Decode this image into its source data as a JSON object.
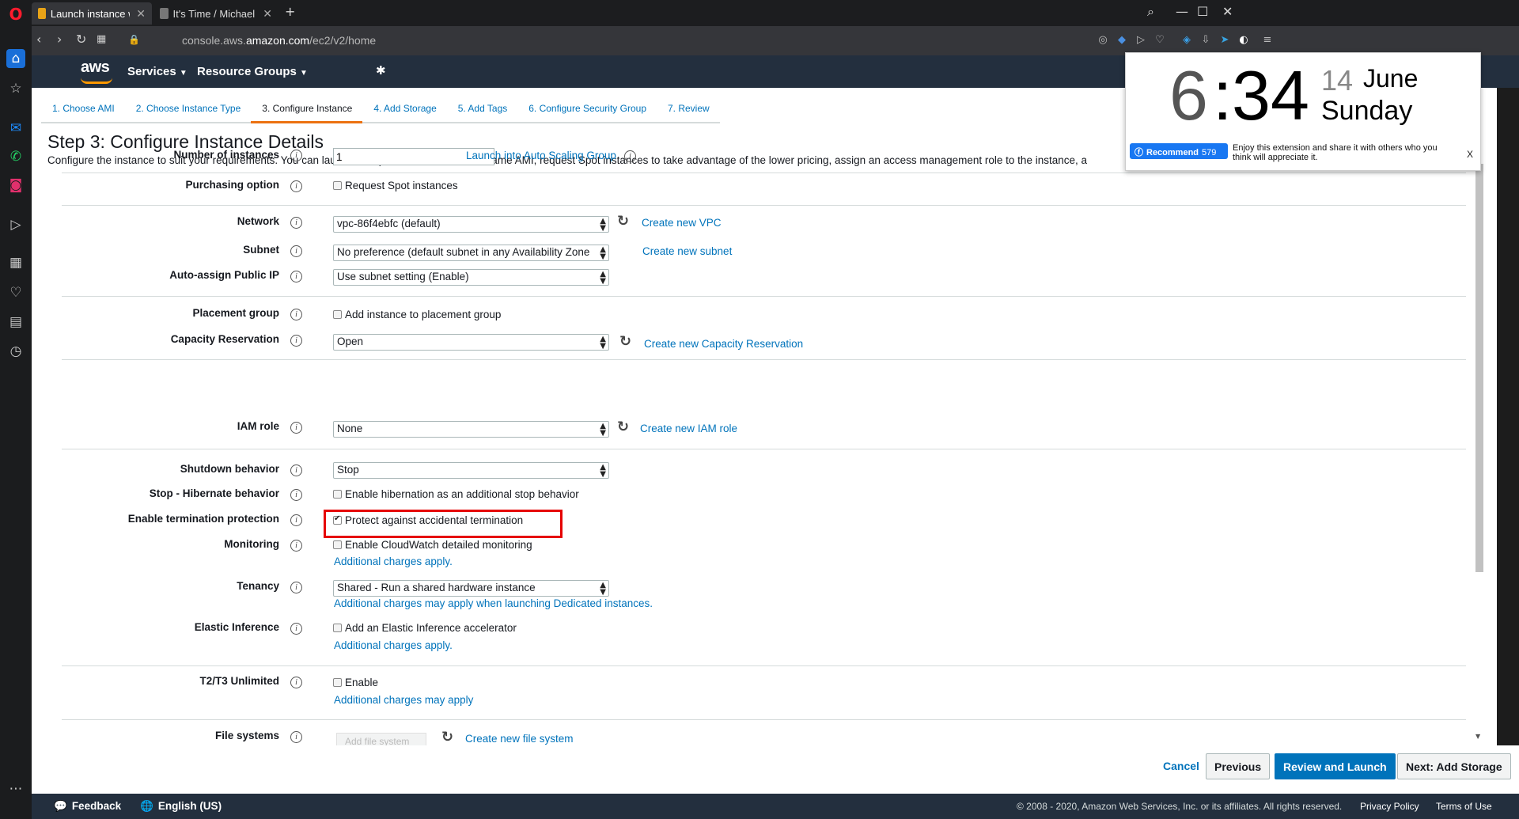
{
  "browser": {
    "tabs": [
      {
        "title": "Launch instance wizard |"
      },
      {
        "title": "It's Time / Michael Bublé"
      }
    ],
    "url_prefix": "console.aws.",
    "url_domain": "amazon.com",
    "url_path": "/ec2/v2/home"
  },
  "aws_header": {
    "logo": "aws",
    "services": "Services",
    "resource_groups": "Resource Groups"
  },
  "wizard": {
    "steps": [
      "1. Choose AMI",
      "2. Choose Instance Type",
      "3. Configure Instance",
      "4. Add Storage",
      "5. Add Tags",
      "6. Configure Security Group",
      "7. Review"
    ],
    "current_step": 2,
    "title": "Step 3: Configure Instance Details",
    "description": "Configure the instance to suit your requirements. You can launch multiple instances from the same AMI, request Spot instances to take advantage of the lower pricing, assign an access management role to the instance, a"
  },
  "form": {
    "num_instances": {
      "label": "Number of instances",
      "value": "1",
      "link": "Launch into Auto Scaling Group"
    },
    "purchasing": {
      "label": "Purchasing option",
      "checkbox": "Request Spot instances",
      "checked": false
    },
    "network": {
      "label": "Network",
      "value": "vpc-86f4ebfc (default)",
      "link": "Create new VPC"
    },
    "subnet": {
      "label": "Subnet",
      "value": "No preference (default subnet in any Availability Zone",
      "link": "Create new subnet"
    },
    "public_ip": {
      "label": "Auto-assign Public IP",
      "value": "Use subnet setting (Enable)"
    },
    "placement": {
      "label": "Placement group",
      "checkbox": "Add instance to placement group",
      "checked": false
    },
    "capacity": {
      "label": "Capacity Reservation",
      "value": "Open",
      "link": "Create new Capacity Reservation"
    },
    "iam": {
      "label": "IAM role",
      "value": "None",
      "link": "Create new IAM role"
    },
    "shutdown": {
      "label": "Shutdown behavior",
      "value": "Stop"
    },
    "hibernate": {
      "label": "Stop - Hibernate behavior",
      "checkbox": "Enable hibernation as an additional stop behavior",
      "checked": false
    },
    "termination": {
      "label": "Enable termination protection",
      "checkbox": "Protect against accidental termination",
      "checked": true
    },
    "monitoring": {
      "label": "Monitoring",
      "checkbox": "Enable CloudWatch detailed monitoring",
      "checked": false,
      "note": "Additional charges apply."
    },
    "tenancy": {
      "label": "Tenancy",
      "value": "Shared - Run a shared hardware instance",
      "note": "Additional charges may apply when launching Dedicated instances."
    },
    "elastic": {
      "label": "Elastic Inference",
      "checkbox": "Add an Elastic Inference accelerator",
      "checked": false,
      "note": "Additional charges apply."
    },
    "t2t3": {
      "label": "T2/T3 Unlimited",
      "checkbox": "Enable",
      "checked": false,
      "note": "Additional charges may apply"
    },
    "filesystems": {
      "label": "File systems",
      "button": "Add file system",
      "link": "Create new file system"
    }
  },
  "actions": {
    "cancel": "Cancel",
    "previous": "Previous",
    "review": "Review and Launch",
    "next": "Next: Add Storage"
  },
  "footer": {
    "feedback": "Feedback",
    "language": "English (US)",
    "copyright": "© 2008 - 2020, Amazon Web Services, Inc. or its affiliates. All rights reserved.",
    "privacy": "Privacy Policy",
    "terms": "Terms of Use"
  },
  "clock_widget": {
    "hour": "6",
    "colon": ":",
    "minute": "34",
    "day": "14",
    "month": "June",
    "weekday": "Sunday",
    "recommend": "Recommend",
    "recommend_count": "579",
    "promo": "Enjoy this extension and share it with others who you think will appreciate it.",
    "close": "X"
  },
  "colors": {
    "aws_header": "#232f3e",
    "aws_orange": "#ff9900",
    "link_blue": "#0073bb",
    "highlight_red": "#e60000",
    "facebook_blue": "#1877f2"
  }
}
